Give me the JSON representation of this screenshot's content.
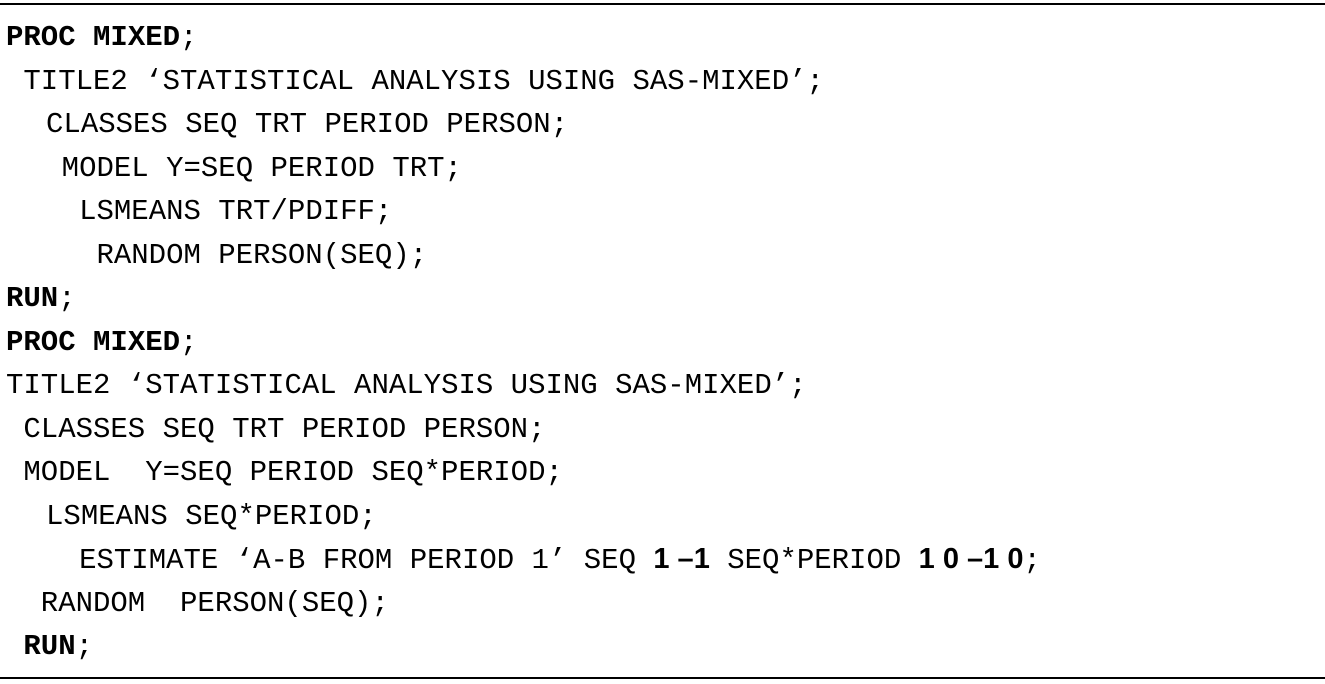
{
  "code": {
    "lines": [
      {
        "indent": 0,
        "segments": [
          {
            "text": "PROC MIXED",
            "style": "bold"
          },
          {
            "text": ";",
            "style": "plain"
          }
        ]
      },
      {
        "indent": 1,
        "segments": [
          {
            "text": "TITLE2 ‘STATISTICAL ANALYSIS USING SAS-MIXED’;",
            "style": "plain"
          }
        ]
      },
      {
        "indent": 2.3,
        "segments": [
          {
            "text": "CLASSES SEQ TRT PERIOD PERSON;",
            "style": "plain"
          }
        ]
      },
      {
        "indent": 3.2,
        "segments": [
          {
            "text": "MODEL Y=SEQ PERIOD TRT;",
            "style": "plain"
          }
        ]
      },
      {
        "indent": 4.2,
        "segments": [
          {
            "text": "LSMEANS TRT/PDIFF;",
            "style": "plain"
          }
        ]
      },
      {
        "indent": 5.2,
        "segments": [
          {
            "text": "RANDOM PERSON(SEQ);",
            "style": "plain"
          }
        ]
      },
      {
        "indent": 0,
        "segments": [
          {
            "text": "RUN",
            "style": "bold"
          },
          {
            "text": ";",
            "style": "plain"
          }
        ]
      },
      {
        "indent": 0,
        "segments": [
          {
            "text": "PROC MIXED",
            "style": "bold"
          },
          {
            "text": ";",
            "style": "plain"
          }
        ]
      },
      {
        "indent": 0,
        "segments": [
          {
            "text": "TITLE2 ‘STATISTICAL ANALYSIS USING SAS-MIXED’;",
            "style": "plain"
          }
        ]
      },
      {
        "indent": 1,
        "segments": [
          {
            "text": "CLASSES SEQ TRT PERIOD PERSON;",
            "style": "plain"
          }
        ]
      },
      {
        "indent": 1,
        "segments": [
          {
            "text": "MODEL  Y=SEQ PERIOD SEQ*PERIOD;",
            "style": "plain"
          }
        ]
      },
      {
        "indent": 2.3,
        "segments": [
          {
            "text": "LSMEANS SEQ*PERIOD;",
            "style": "plain"
          }
        ]
      },
      {
        "indent": 4.2,
        "segments": [
          {
            "text": "ESTIMATE ‘A-B FROM PERIOD 1’ SEQ ",
            "style": "plain"
          },
          {
            "text": "1 –1",
            "style": "sans-bold"
          },
          {
            "text": " SEQ*PERIOD ",
            "style": "plain"
          },
          {
            "text": "1 0 –1 0",
            "style": "sans-bold"
          },
          {
            "text": ";",
            "style": "plain"
          }
        ]
      },
      {
        "indent": 2,
        "segments": [
          {
            "text": "RANDOM  PERSON(SEQ);",
            "style": "plain"
          }
        ]
      },
      {
        "indent": 1,
        "segments": [
          {
            "text": "RUN",
            "style": "bold"
          },
          {
            "text": ";",
            "style": "plain"
          }
        ]
      }
    ]
  }
}
